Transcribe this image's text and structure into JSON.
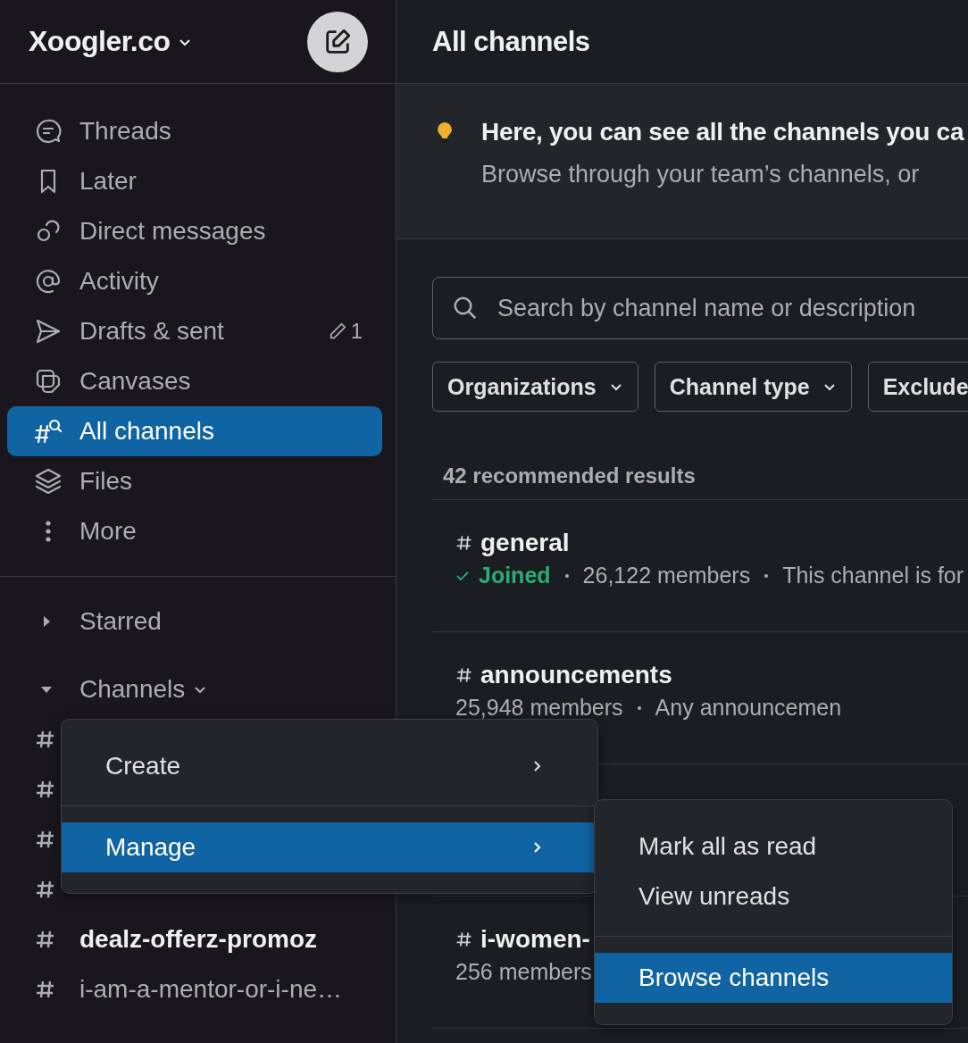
{
  "workspace": {
    "name": "Xoogler.co"
  },
  "sidebar": {
    "nav_items": [
      {
        "label": "Threads",
        "kind": "threads",
        "selected": false
      },
      {
        "label": "Later",
        "kind": "later",
        "selected": false
      },
      {
        "label": "Direct messages",
        "kind": "messages",
        "selected": false
      },
      {
        "label": "Activity",
        "kind": "activity",
        "selected": false
      },
      {
        "label": "Drafts & sent",
        "kind": "drafts",
        "selected": false,
        "badge": "1"
      },
      {
        "label": "Canvases",
        "kind": "canvases",
        "selected": false
      },
      {
        "label": "All channels",
        "kind": "channels",
        "selected": true
      },
      {
        "label": "Files",
        "kind": "files",
        "selected": false
      },
      {
        "label": "More",
        "kind": "more",
        "selected": false
      }
    ],
    "sections": [
      {
        "label": "Starred",
        "expanded": false
      },
      {
        "label": "Channels",
        "expanded": true
      }
    ],
    "channels": [
      {
        "kind": "covered"
      },
      {
        "kind": "covered"
      },
      {
        "kind": "covered"
      },
      {
        "kind": "covered"
      },
      {
        "kind": "named",
        "name": "dealz-offerz-promoz",
        "unread": true
      },
      {
        "kind": "named",
        "name": "i-am-a-mentor-or-i-ne…",
        "unread": false
      }
    ]
  },
  "main": {
    "title": "All channels",
    "banner": {
      "title": "Here, you can see all the channels you ca",
      "text": "Browse through your team’s channels, or"
    },
    "search": {
      "placeholder": "Search by channel name or description"
    },
    "filters": [
      {
        "label": "Organizations",
        "dropdown": true
      },
      {
        "label": "Channel type",
        "dropdown": true
      },
      {
        "label": "Exclude",
        "dropdown": false
      }
    ],
    "result_count": "42 recommended results",
    "results": [
      {
        "name": "general",
        "joined": true,
        "joined_label": "Joined",
        "members": "26,122 members",
        "description": "This channel is for"
      },
      {
        "name": "announcements",
        "joined": false,
        "members": "25,948 members",
        "description": "Any announcemen"
      },
      {
        "name": "i-women-",
        "joined": false,
        "members": "256 members"
      }
    ]
  },
  "menu": {
    "groups": [
      [
        {
          "label": "Create",
          "selected": false
        }
      ],
      [
        {
          "label": "Manage",
          "selected": true
        }
      ]
    ]
  },
  "submenu": {
    "groups": [
      [
        {
          "label": "Mark all as read",
          "selected": false
        },
        {
          "label": "View unreads",
          "selected": false
        }
      ],
      [
        {
          "label": "Browse channels",
          "selected": true
        }
      ]
    ]
  }
}
